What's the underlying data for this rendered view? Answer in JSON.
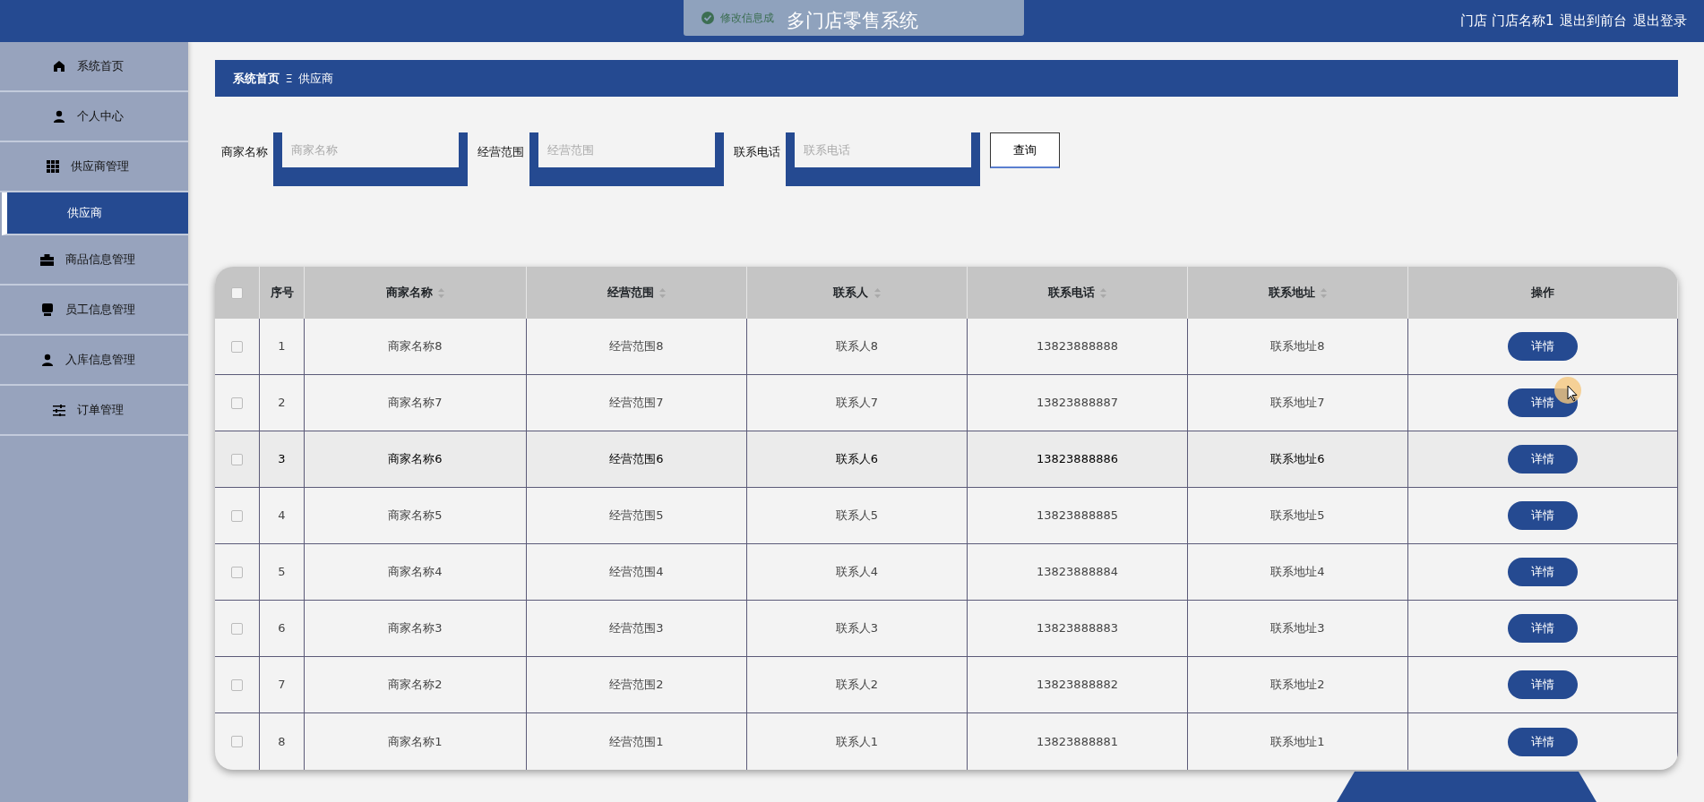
{
  "toast": {
    "text": "修改信息成"
  },
  "header": {
    "title": "多门店零售系统",
    "links": [
      "门店 门店名称1",
      "退出到前台",
      "退出登录"
    ]
  },
  "sidebar": {
    "items": [
      {
        "label": "系统首页",
        "selected": false,
        "kind": "menu"
      },
      {
        "label": "个人中心",
        "selected": false,
        "kind": "menu"
      },
      {
        "label": "供应商管理",
        "selected": false,
        "kind": "menu"
      },
      {
        "label": "供应商",
        "selected": true,
        "kind": "submenu"
      },
      {
        "label": "商品信息管理",
        "selected": false,
        "kind": "menu"
      },
      {
        "label": "员工信息管理",
        "selected": false,
        "kind": "menu"
      },
      {
        "label": "入库信息管理",
        "selected": false,
        "kind": "menu"
      },
      {
        "label": "订单管理",
        "selected": false,
        "kind": "menu"
      }
    ]
  },
  "breadcrumb": {
    "home": "系统首页",
    "separator": "Ξ",
    "current": "供应商"
  },
  "search": {
    "fields": [
      {
        "label": "商家名称",
        "placeholder": "商家名称"
      },
      {
        "label": "经营范围",
        "placeholder": "经营范围"
      },
      {
        "label": "联系电话",
        "placeholder": "联系电话"
      }
    ],
    "button": "查询"
  },
  "table": {
    "select_all": false,
    "columns": [
      {
        "label": "序号",
        "sortable": false
      },
      {
        "label": "商家名称",
        "sortable": true
      },
      {
        "label": "经营范围",
        "sortable": true
      },
      {
        "label": "联系人",
        "sortable": true
      },
      {
        "label": "联系电话",
        "sortable": true
      },
      {
        "label": "联系地址",
        "sortable": true
      },
      {
        "label": "操作",
        "sortable": false
      }
    ],
    "rows": [
      {
        "checked": false,
        "highlighted": false,
        "cells": [
          "1",
          "商家名称8",
          "经营范围8",
          "联系人8",
          "13823888888",
          "联系地址8"
        ],
        "action": "详情"
      },
      {
        "checked": false,
        "highlighted": false,
        "cells": [
          "2",
          "商家名称7",
          "经营范围7",
          "联系人7",
          "13823888887",
          "联系地址7"
        ],
        "action": "详情"
      },
      {
        "checked": false,
        "highlighted": true,
        "cells": [
          "3",
          "商家名称6",
          "经营范围6",
          "联系人6",
          "13823888886",
          "联系地址6"
        ],
        "action": "详情"
      },
      {
        "checked": false,
        "highlighted": false,
        "cells": [
          "4",
          "商家名称5",
          "经营范围5",
          "联系人5",
          "13823888885",
          "联系地址5"
        ],
        "action": "详情"
      },
      {
        "checked": false,
        "highlighted": false,
        "cells": [
          "5",
          "商家名称4",
          "经营范围4",
          "联系人4",
          "13823888884",
          "联系地址4"
        ],
        "action": "详情"
      },
      {
        "checked": false,
        "highlighted": false,
        "cells": [
          "6",
          "商家名称3",
          "经营范围3",
          "联系人3",
          "13823888883",
          "联系地址3"
        ],
        "action": "详情"
      },
      {
        "checked": false,
        "highlighted": false,
        "cells": [
          "7",
          "商家名称2",
          "经营范围2",
          "联系人2",
          "13823888882",
          "联系地址2"
        ],
        "action": "详情"
      },
      {
        "checked": false,
        "highlighted": false,
        "cells": [
          "8",
          "商家名称1",
          "经营范围1",
          "联系人1",
          "13823888881",
          "联系地址1"
        ],
        "action": "详情"
      }
    ]
  }
}
